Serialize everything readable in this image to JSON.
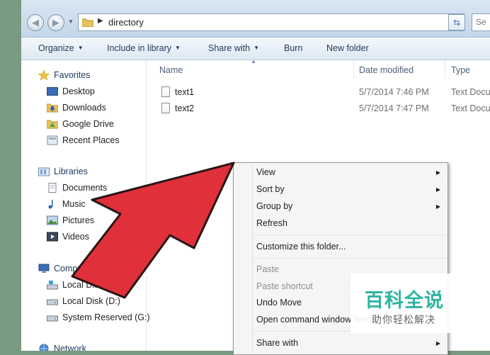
{
  "address": {
    "path": "directory"
  },
  "search": {
    "placeholder": "Se"
  },
  "toolbar": {
    "organize": "Organize",
    "include_in_library": "Include in library",
    "share_with": "Share with",
    "burn": "Burn",
    "new_folder": "New folder"
  },
  "nav": {
    "favorites": "Favorites",
    "desktop": "Desktop",
    "downloads": "Downloads",
    "google_drive": "Google Drive",
    "recent_places": "Recent Places",
    "libraries": "Libraries",
    "documents": "Documents",
    "music": "Music",
    "pictures": "Pictures",
    "videos": "Videos",
    "computer": "Computer",
    "local_disk_c": "Local Disk (C:)",
    "local_disk_d": "Local Disk (D:)",
    "system_reserved": "System Reserved (G:)",
    "network": "Network"
  },
  "columns": {
    "name": "Name",
    "date_modified": "Date modified",
    "type": "Type"
  },
  "files": [
    {
      "name": "text1",
      "date": "5/7/2014 7:46 PM",
      "type": "Text Document"
    },
    {
      "name": "text2",
      "date": "5/7/2014 7:47 PM",
      "type": "Text Document"
    }
  ],
  "context_menu": {
    "view": "View",
    "sort_by": "Sort by",
    "group_by": "Group by",
    "refresh": "Refresh",
    "customize": "Customize this folder...",
    "paste": "Paste",
    "paste_shortcut": "Paste shortcut",
    "undo_move": "Undo Move",
    "open_command_window": "Open command window here",
    "share_with": "Share with"
  },
  "watermark": {
    "logo": "百科全说",
    "slogan": "助你轻松解决"
  },
  "colors": {
    "arrow": "#e0303a",
    "watermark": "#2fb4a2",
    "toolbar_text": "#1e395b"
  }
}
